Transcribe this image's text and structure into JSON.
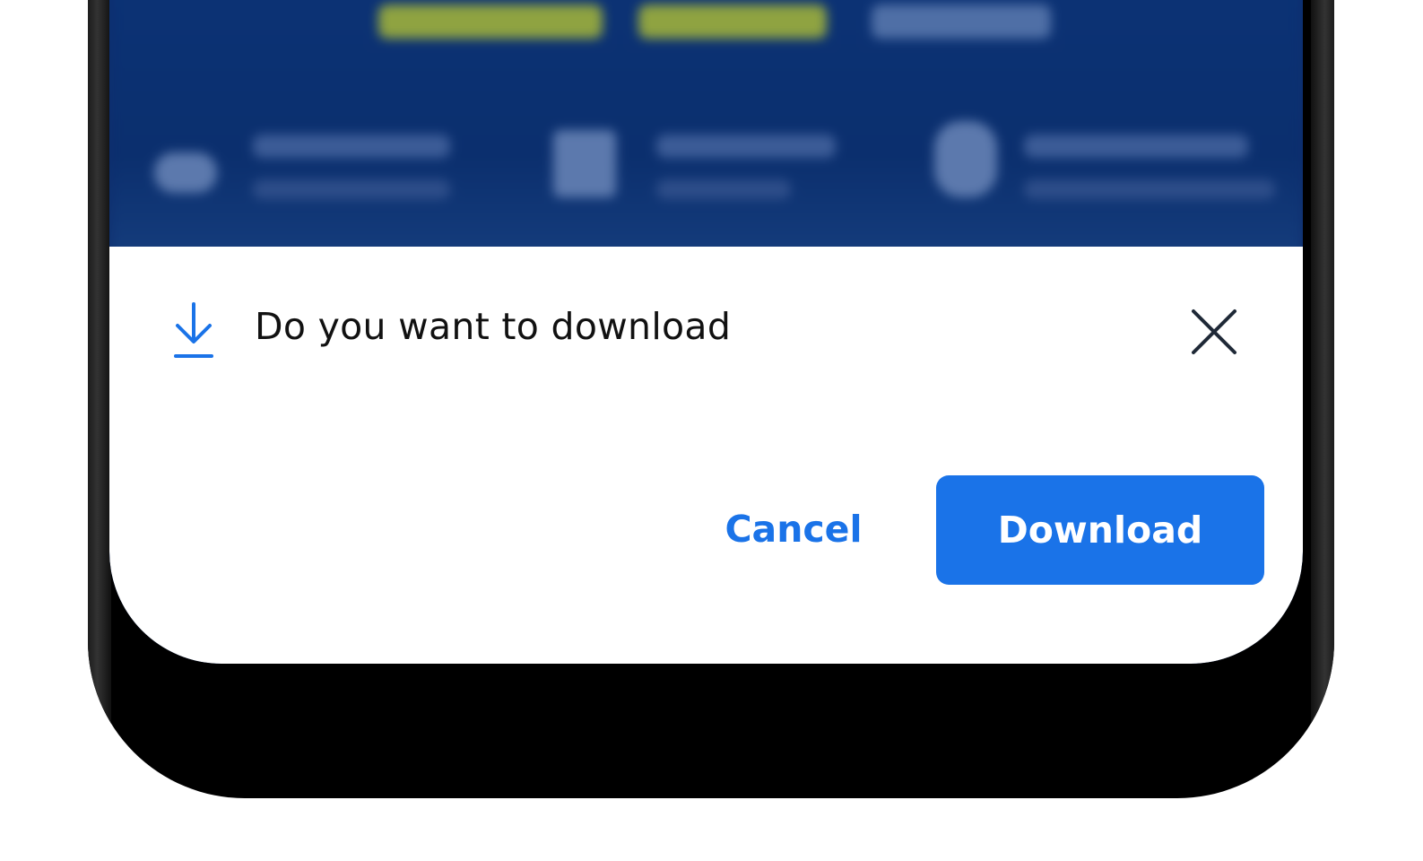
{
  "dialog": {
    "title": "Do you want to download",
    "cancel_label": "Cancel",
    "download_label": "Download",
    "icons": {
      "leading": "download-arrow-icon",
      "close": "close-icon"
    }
  },
  "colors": {
    "accent": "#1a73e8",
    "background_page": "#0c3479",
    "sheet": "#ffffff",
    "title_text": "#111111",
    "close_icon": "#1f2937"
  }
}
